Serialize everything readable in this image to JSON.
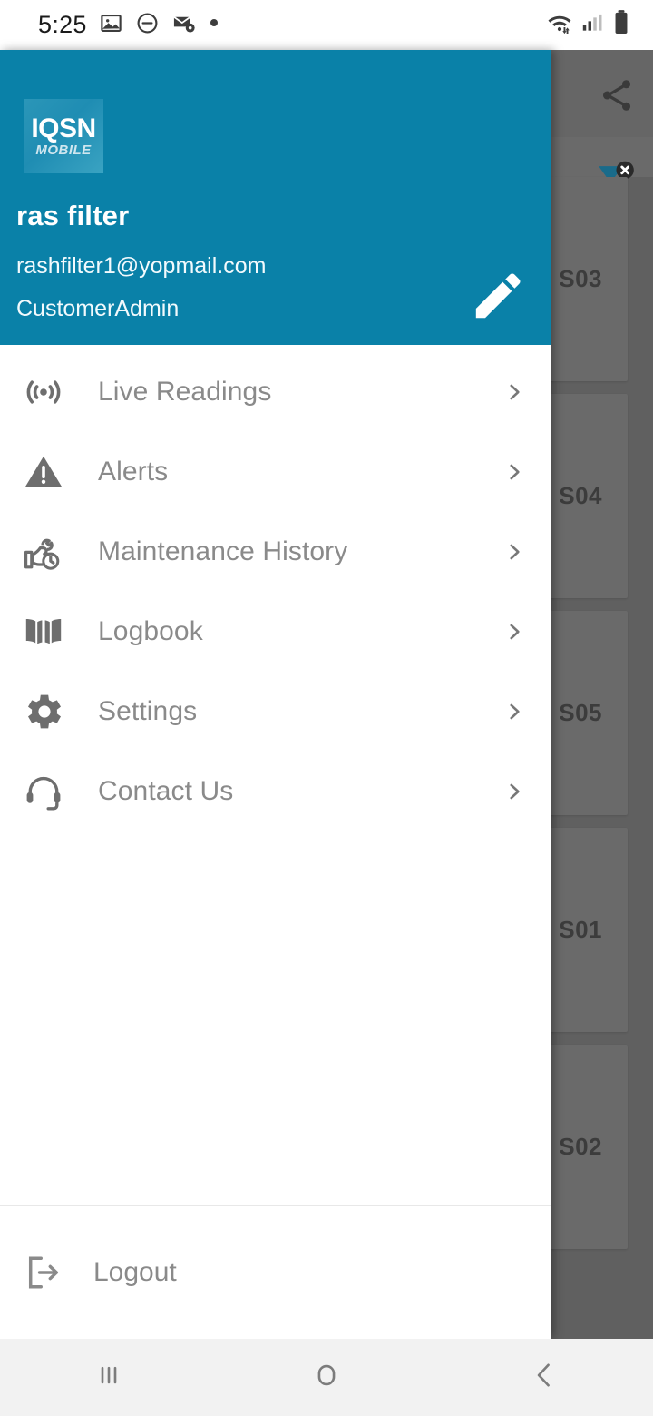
{
  "status_bar": {
    "clock": "5:25",
    "left_icons": [
      "image-icon",
      "do-not-disturb-icon",
      "mail-settings-icon",
      "dot-icon"
    ],
    "right_icons": [
      "wifi-icon",
      "cellular-signal-icon",
      "battery-icon"
    ]
  },
  "drawer": {
    "logo": {
      "main": "IQSN",
      "sub": "MOBILE"
    },
    "user": {
      "name": "ras  filter",
      "email": "rashfilter1@yopmail.com",
      "role": "CustomerAdmin"
    },
    "edit_icon": "pencil-icon",
    "menu_items": [
      {
        "label": "Live Readings",
        "icon": "live-readings-icon"
      },
      {
        "label": "Alerts",
        "icon": "alert-triangle-icon"
      },
      {
        "label": "Maintenance History",
        "icon": "maintenance-icon"
      },
      {
        "label": "Logbook",
        "icon": "book-icon"
      },
      {
        "label": "Settings",
        "icon": "gear-icon"
      },
      {
        "label": "Contact Us",
        "icon": "headset-icon"
      }
    ],
    "chevron_icon": "chevron-right-icon",
    "logout": {
      "label": "Logout",
      "icon": "logout-icon"
    }
  },
  "background": {
    "share_icon": "share-icon",
    "filter_icon": "filter-clear-icon",
    "cards": [
      {
        "label": "S03"
      },
      {
        "label": "S04"
      },
      {
        "label": "S05"
      },
      {
        "label": "S01"
      },
      {
        "label": "S02"
      }
    ]
  },
  "nav_bar": {
    "buttons": [
      {
        "name": "recents-button",
        "icon": "recents-icon"
      },
      {
        "name": "home-button",
        "icon": "home-circle-icon"
      },
      {
        "name": "back-button",
        "icon": "back-chevron-icon"
      }
    ]
  },
  "colors": {
    "brand_blue": "#0a81a8",
    "overlay_gray": "#606060",
    "card_gray": "#6a6a6a",
    "menu_text": "#8a8a8a",
    "nav_bg": "#f2f2f2"
  }
}
